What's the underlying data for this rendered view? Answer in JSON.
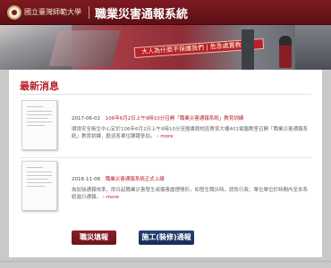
{
  "header": {
    "university": "國立臺灣師範大學",
    "system_title": "職業災害通報系統"
  },
  "banner": {
    "sign_text": "大人為什麼不保護我們 | 危急處置教材"
  },
  "news": {
    "section_title": "最新消息",
    "items": [
      {
        "date": "2017-06-02",
        "title": "106年6月2日上午9時10分召開「職業災害通報系統」教育訓練",
        "body": "環境安全衛生中心定於106年6月2日上午9時10分至圖書館校區教育大樓401電腦教室召開「職業災害通報系統」教育訓練，歡迎各單位踴躍參加。",
        "more": "more"
      },
      {
        "date": "2016-11-08",
        "title": "職業災害通報系統正式上線",
        "body": "為加強通報效率，即日起職業災害發生或傷害處理情形，如發生職災時，請負行政、單位單位於時間內至本系統進行通報。",
        "more": "more"
      }
    ]
  },
  "buttons": {
    "report": "職災填報",
    "construction": "施工(裝修)通報"
  },
  "colors": {
    "brand_red": "#7d1a22",
    "accent_red": "#b4202a",
    "navy": "#1f3a6e"
  }
}
